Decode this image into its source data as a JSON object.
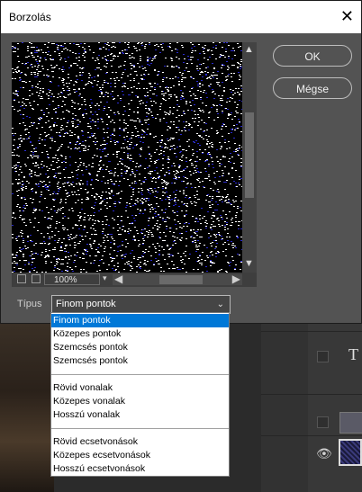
{
  "dialog": {
    "title": "Borzolás",
    "ok_label": "OK",
    "cancel_label": "Mégse",
    "zoom": "100%",
    "type_label": "Típus",
    "selected_type": "Finom pontok"
  },
  "dropdown_options": [
    "Finom pontok",
    "Közepes pontok",
    "Szemcsés pontok",
    "Szemcsés pontok",
    "Rövid vonalak",
    "Közepes vonalak",
    "Hosszú vonalak",
    "Rövid ecsetvonások",
    "Közepes ecsetvonások",
    "Hosszú ecsetvonások"
  ],
  "background": {
    "layer_letter": "T"
  },
  "colors": {
    "dialog_bg": "#535353",
    "selection": "#0078d7",
    "noise_white": "#ffffff",
    "noise_blue": "#2a2ad0"
  },
  "icons": [
    "close-icon",
    "scroll-up-icon",
    "scroll-down-icon",
    "scroll-left-icon",
    "scroll-right-icon",
    "chevron-down-icon",
    "eye-icon"
  ]
}
